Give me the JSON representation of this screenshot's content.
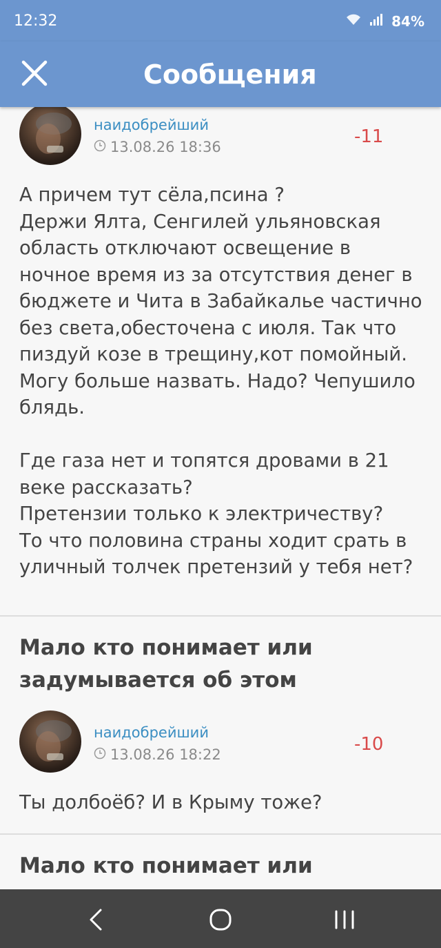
{
  "status_bar": {
    "time": "12:32",
    "battery": "84%"
  },
  "app_bar": {
    "title": "Сообщения"
  },
  "posts": [
    {
      "author": "наидобрейший",
      "date": "13.08.26 18:36",
      "score": "-11",
      "text": "А причем тут сёла,псина ?\nДержи Ялта, Сенгилей ульяновская\nобласть отключают освещение в\nночное время из за отсутствия денег в\nбюджете и Чита в Забайкалье частично\nбез света,обесточена с июля. Так что\nпиздуй козе в трещину,кот помойный.\nМогу больше назвать. Надо? Чепушило\nблядь.\n\nГде газа нет и топятся дровами в 21\nвеке рассказать?\nПретензии только к электричеству?\nТо что половина страны ходит срать в\nуличный толчек претензий у тебя нет?"
    },
    {
      "topic": "Мало кто понимает или задумывается об этом",
      "author": "наидобрейший",
      "date": "13.08.26 18:22",
      "score": "-10",
      "text": "Ты долбоёб? И в Крыму тоже?"
    },
    {
      "topic": "Мало кто понимает или"
    }
  ],
  "colors": {
    "header": "#6c96cf",
    "author": "#3b8ec2",
    "score": "#d94a4a",
    "nav_bar": "#444444"
  }
}
